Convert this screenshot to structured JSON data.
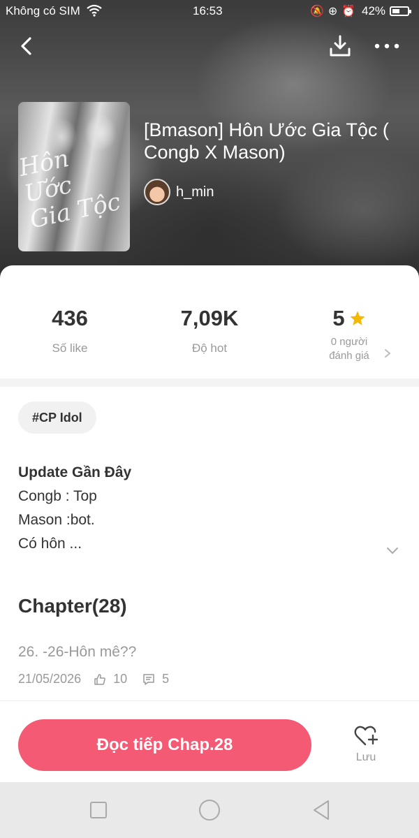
{
  "status_bar": {
    "carrier": "Không có SIM",
    "time": "16:53",
    "battery": "42%",
    "icons": [
      "wifi-icon",
      "bell-off-icon",
      "lock-rotation-icon",
      "alarm-icon",
      "battery-icon"
    ]
  },
  "header": {
    "icons": [
      "back-icon",
      "download-icon",
      "more-icon"
    ]
  },
  "book": {
    "title": "[Bmason] Hôn Ước Gia Tộc ( Congb X Mason)",
    "author": "h_min",
    "cover_script": [
      "Hôn Ước",
      "Gia Tộc"
    ]
  },
  "stats": {
    "likes_value": "436",
    "likes_label": "Số like",
    "hot_value": "7,09K",
    "hot_label": "Độ hot",
    "rating_value": "5",
    "rating_label_line1": "0 người",
    "rating_label_line2": "đánh giá",
    "star_color": "#f5b800"
  },
  "tag": "#CP Idol",
  "description": {
    "heading": "Update Gần Đây",
    "lines": [
      "Congb : Top",
      "Mason :bot.",
      "Có hôn ..."
    ]
  },
  "chapters": {
    "title": "Chapter(28)",
    "latest": {
      "name": "26. -26-Hôn mê??",
      "date": "21/05/2026",
      "likes": "10",
      "comments": "5"
    }
  },
  "actions": {
    "read_label": "Đọc tiếp Chap.28",
    "save_label": "Lưu",
    "accent": "#f45a73"
  },
  "nav": [
    "recent-apps-icon",
    "home-icon",
    "back-nav-icon"
  ]
}
